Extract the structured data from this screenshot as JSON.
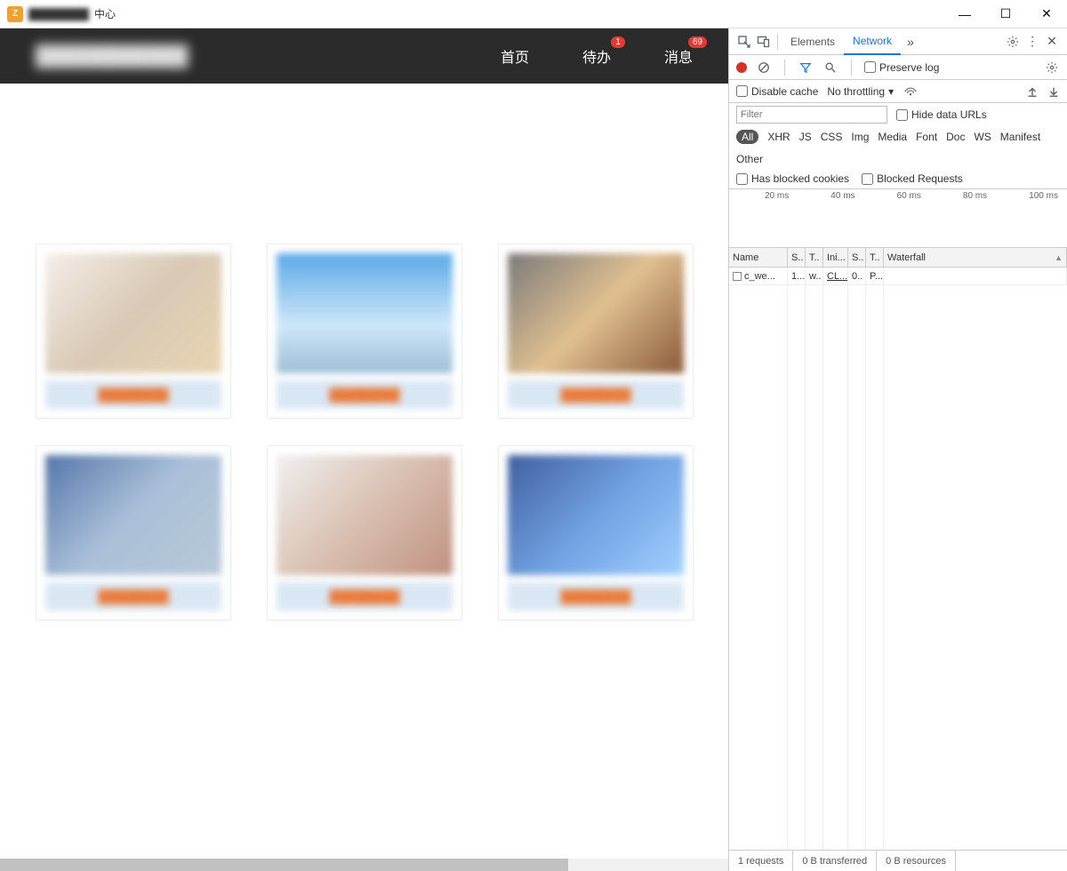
{
  "window": {
    "title_blurred": "████████",
    "title_suffix": "中心",
    "minimize": "—",
    "maximize": "☐",
    "close": "✕"
  },
  "app": {
    "logo_blurred": "███████████",
    "nav": {
      "home": "首页",
      "todo": "待办",
      "todo_badge": "1",
      "msg": "消息",
      "msg_badge": "69"
    },
    "cards": [
      {
        "label": "████████"
      },
      {
        "label": "████████"
      },
      {
        "label": "████████"
      },
      {
        "label": "████████"
      },
      {
        "label": "████████"
      },
      {
        "label": "████████"
      }
    ]
  },
  "devtools": {
    "tabs": {
      "elements": "Elements",
      "network": "Network"
    },
    "toolbar": {
      "preserve_log": "Preserve log",
      "disable_cache": "Disable cache",
      "no_throttling": "No throttling",
      "filter_placeholder": "Filter",
      "hide_data_urls": "Hide data URLs",
      "has_blocked_cookies": "Has blocked cookies",
      "blocked_requests": "Blocked Requests"
    },
    "types": {
      "all": "All",
      "xhr": "XHR",
      "js": "JS",
      "css": "CSS",
      "img": "Img",
      "media": "Media",
      "font": "Font",
      "doc": "Doc",
      "ws": "WS",
      "manifest": "Manifest",
      "other": "Other"
    },
    "timeline": {
      "t20": "20 ms",
      "t40": "40 ms",
      "t60": "60 ms",
      "t80": "80 ms",
      "t100": "100 ms"
    },
    "columns": {
      "name": "Name",
      "s1": "S..",
      "t1": "T..",
      "ini": "Ini...",
      "s2": "S..",
      "t2": "T..",
      "waterfall": "Waterfall"
    },
    "rows": [
      {
        "name": "c_we...",
        "s": "1...",
        "t": "w..",
        "ini": "CL...",
        "sz": "0..",
        "tm": "P..."
      }
    ],
    "status": {
      "requests": "1 requests",
      "transferred": "0 B transferred",
      "resources": "0 B resources"
    }
  }
}
